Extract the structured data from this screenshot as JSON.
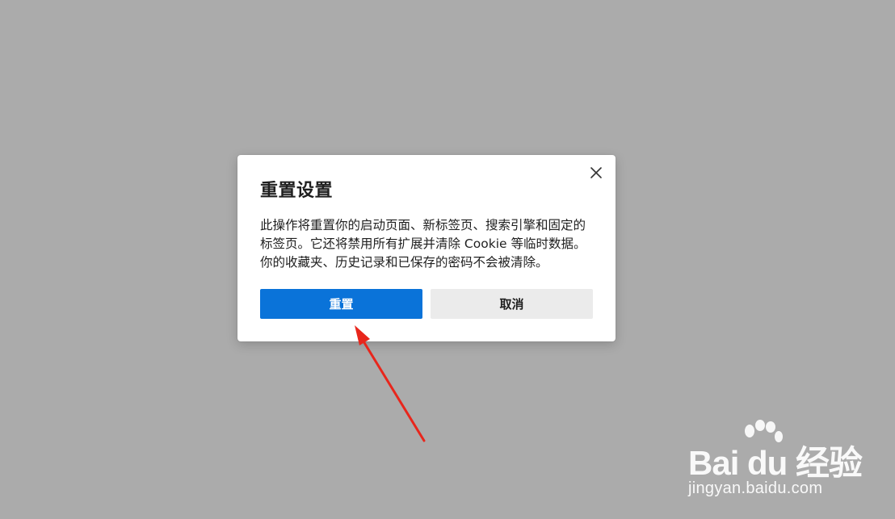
{
  "dialog": {
    "title": "重置设置",
    "body": "此操作将重置你的启动页面、新标签页、搜索引擎和固定的标签页。它还将禁用所有扩展并清除 Cookie 等临时数据。你的收藏夹、历史记录和已保存的密码不会被清除。",
    "reset_label": "重置",
    "cancel_label": "取消",
    "close_icon": "close-icon"
  },
  "watermark": {
    "brand": "Bai du 经验",
    "url": "jingyan.baidu.com"
  },
  "colors": {
    "overlay": "#ababab",
    "primary": "#0a73d9",
    "secondary": "#ebebeb",
    "arrow": "#e8261c"
  }
}
